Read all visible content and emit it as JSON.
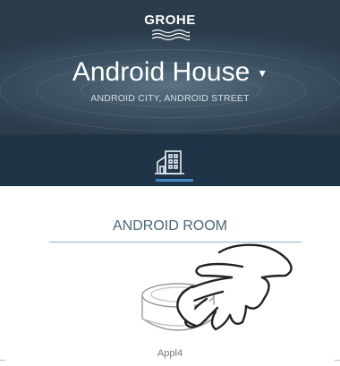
{
  "header": {
    "brand": "GROHE",
    "house_name": "Android House",
    "address": "ANDROID CITY, ANDROID STREET"
  },
  "tabs": [
    {
      "icon": "house-icon",
      "active": true
    }
  ],
  "room": {
    "title": "ANDROID ROOM"
  },
  "appliance": {
    "label": "Appl4",
    "icon": "sense-sensor-icon"
  },
  "colors": {
    "header_bg": "#3f5566",
    "tabbar_bg": "#1f3547",
    "accent": "#3f88c5",
    "room_text": "#4b6878"
  }
}
